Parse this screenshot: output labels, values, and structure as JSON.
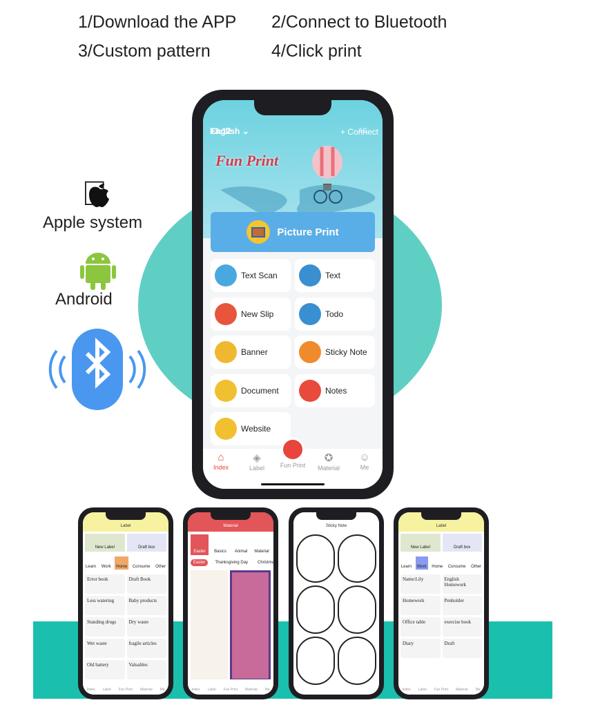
{
  "steps": [
    "1/Download the APP",
    "2/Connect to Bluetooth",
    "3/Custom pattern",
    "4/Click print"
  ],
  "platforms": {
    "apple": "Apple system",
    "android": "Android",
    "bluetooth_icon": "bluetooth-icon"
  },
  "colors": {
    "teal": "#5fcfc4",
    "band": "#1bbfae",
    "accent": "#e8453c",
    "picture_print": "#5aaee8"
  },
  "main_phone": {
    "status": {
      "time": "13:12",
      "network": "5G"
    },
    "header": {
      "language": "English",
      "connect": "+ Connect"
    },
    "logo": "Fun Print",
    "picture_print": "Picture Print",
    "features": [
      {
        "label": "Text Scan",
        "icon": "text-scan-icon",
        "color": "#4aa8e0"
      },
      {
        "label": "Text",
        "icon": "pencil-icon",
        "color": "#3a8fd0"
      },
      {
        "label": "New Slip",
        "icon": "slip-icon",
        "color": "#e8553c"
      },
      {
        "label": "Todo",
        "icon": "clipboard-icon",
        "color": "#3a8fd0"
      },
      {
        "label": "Banner",
        "icon": "banner-icon",
        "color": "#f0b830"
      },
      {
        "label": "Sticky Note",
        "icon": "sticky-note-icon",
        "color": "#f08a2c"
      },
      {
        "label": "Document",
        "icon": "folder-icon",
        "color": "#f0c030"
      },
      {
        "label": "Notes",
        "icon": "rocket-icon",
        "color": "#e84a3c"
      },
      {
        "label": "Website",
        "icon": "website-icon",
        "color": "#f0c030"
      }
    ],
    "tabs": [
      {
        "label": "Index",
        "active": true
      },
      {
        "label": "Label"
      },
      {
        "label": "Fun Print"
      },
      {
        "label": "Material"
      },
      {
        "label": "Me"
      }
    ]
  },
  "mini_phones": [
    {
      "title": "Label",
      "new_label": "New Label",
      "draft_box": "Draft box",
      "cats": [
        "Learn",
        "Work",
        "Home",
        "Consume",
        "Other"
      ],
      "items": [
        "Error book",
        "Draft Book",
        "Less watering",
        "Baby products",
        "Standing drugs",
        "Dry waste",
        "Wet waste",
        "fragile articles",
        "Old battery",
        "Valuables"
      ]
    },
    {
      "title": "Material",
      "cats": [
        "Easter",
        "Basics",
        "Animal",
        "Material"
      ],
      "festivals": [
        "Easter",
        "Thanksgiving Day",
        "Christmas"
      ]
    },
    {
      "title": "Sticky Note"
    },
    {
      "title": "Label",
      "new_label": "New Label",
      "draft_box": "Draft box",
      "cats": [
        "Learn",
        "Work",
        "Home",
        "Consume",
        "Other"
      ],
      "items": [
        "Name:Lily",
        "English Homework",
        "Homework",
        "Penholder",
        "Office table",
        "exercise book",
        "Diary",
        "Draft"
      ]
    }
  ],
  "mini_tabs": [
    "Index",
    "Label",
    "Fun Print",
    "Material",
    "Me"
  ]
}
